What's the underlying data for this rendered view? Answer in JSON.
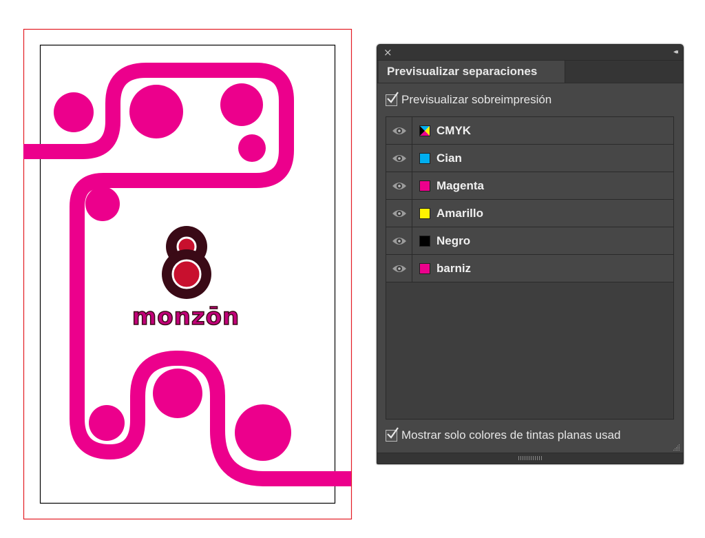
{
  "colors": {
    "magenta": "#ec008c",
    "logo_dark": "#3a0a16",
    "logo_red": "#c8102e",
    "bleed_line": "#e31b23",
    "trim_line": "#000000",
    "panel_bg": "#474747"
  },
  "artwork": {
    "logo_word": "monzōn"
  },
  "panel": {
    "close_icon": "×",
    "collapse_icon": "◂◂",
    "tab_label": "Previsualizar separaciones",
    "overprint_label": "Previsualizar sobreimpresión",
    "overprint_checked": true,
    "bottom_label": "Mostrar solo colores de tintas planas usad",
    "bottom_checked": true,
    "separations": [
      {
        "label": "CMYK",
        "swatch": "cmyk",
        "visible": true
      },
      {
        "label": "Cian",
        "swatch": "#00aeef",
        "visible": true
      },
      {
        "label": "Magenta",
        "swatch": "#ec008c",
        "visible": true
      },
      {
        "label": "Amarillo",
        "swatch": "#fff200",
        "visible": true
      },
      {
        "label": "Negro",
        "swatch": "#000000",
        "visible": true
      },
      {
        "label": "barniz",
        "swatch": "#ec008c",
        "visible": true
      }
    ]
  }
}
